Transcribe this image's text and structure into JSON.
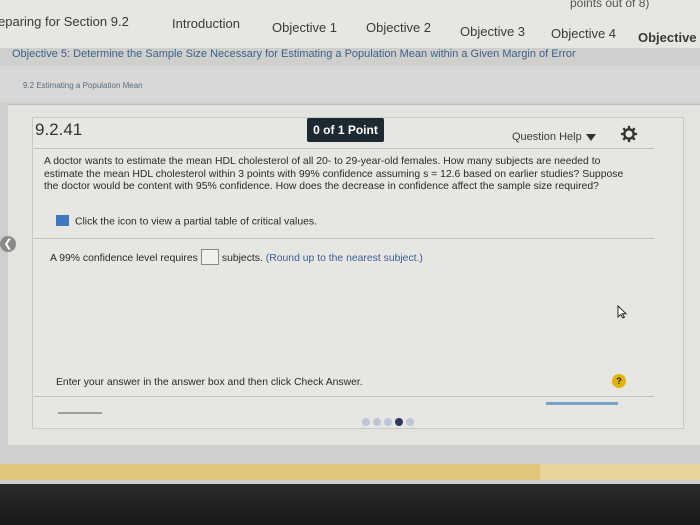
{
  "header": {
    "count_partial": "points out of 8)",
    "tabs": [
      {
        "label": "eparing for Section 9.2"
      },
      {
        "label": "Introduction"
      },
      {
        "label": "Objective 1"
      },
      {
        "label": "Objective 2"
      },
      {
        "label": "Objective 3"
      },
      {
        "label": "Objective 4"
      },
      {
        "label": "Objective"
      }
    ]
  },
  "objective_title": "Objective 5: Determine the Sample Size Necessary for Estimating a Population Mean within a Given Margin of Error",
  "section_crumb": "9.2 Estimating a Population Mean",
  "question": {
    "number": "9.2.41",
    "points": "0 of 1 Point",
    "help_label": "Question Help",
    "text": "A doctor wants to estimate the mean HDL cholesterol of all 20- to 29-year-old females. How many subjects are needed to estimate the mean HDL cholesterol within 3 points with 99% confidence assuming s = 12.6 based on earlier studies? Suppose the doctor would be content with 95% confidence. How does the decrease in confidence affect the sample size required?",
    "hint": "Click the icon to view a partial table of critical values.",
    "answer_prefix": "A 99% confidence level requires",
    "answer_value": "",
    "answer_suffix": "subjects.",
    "answer_note": "(Round up to the nearest subject.)"
  },
  "footer": {
    "instruction": "Enter your answer in the answer box and then click Check Answer.",
    "help_icon": "?"
  },
  "colors": {
    "points_badge": "#1e2a33",
    "help_badge": "#e2b400",
    "link": "#3c5f99"
  }
}
